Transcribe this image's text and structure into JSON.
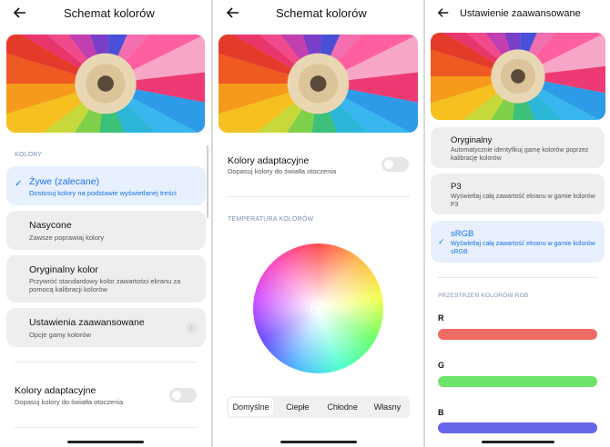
{
  "screen1": {
    "title": "Schemat kolorów",
    "section_label": "KOLORY",
    "options": [
      {
        "title": "Żywe (zalecane)",
        "desc": "Dostosuj kolory na podstawie wyświetlanej treści",
        "selected": true
      },
      {
        "title": "Nasycone",
        "desc": "Zawsze poprawiaj kolory"
      },
      {
        "title": "Oryginalny kolor",
        "desc": "Przywróć standardowy kolor zawartości ekranu za pomocą kalibracji kolorów"
      },
      {
        "title": "Ustawienia zaawansowane",
        "desc": "Opcje gamy kolorów"
      }
    ],
    "adaptive": {
      "title": "Kolory adaptacyjne",
      "desc": "Dopasuj kolory do światła otoczenia",
      "enabled": false
    }
  },
  "screen2": {
    "title": "Schemat kolorów",
    "adaptive": {
      "title": "Kolory adaptacyjne",
      "desc": "Dopasuj kolory do światła otoczenia",
      "enabled": false
    },
    "section_label": "TEMPERATURA KOLORÓW",
    "tabs": [
      "Domyślne",
      "Ciepłe",
      "Chłodne",
      "Własny"
    ],
    "active_tab": "Domyślne"
  },
  "screen3": {
    "title": "Ustawienie zaawansowane",
    "options": [
      {
        "title": "Oryginalny",
        "desc": "Automatycznie identyfikuj gamę kolorów poprzez kalibrację kolorów"
      },
      {
        "title": "P3",
        "desc": "Wyświetlaj całą zawartość ekranu w gamie kolorów P3"
      },
      {
        "title": "sRGB",
        "desc": "Wyświetlaj całą zawartość ekranu w gamie kolorów sRGB",
        "selected": true
      }
    ],
    "section_label": "PRZESTRZEŃ KOLORÓW RGB",
    "channels": [
      {
        "label": "R",
        "color": "#ef6a63"
      },
      {
        "label": "G",
        "color": "#6fe46a"
      },
      {
        "label": "B",
        "color": "#6666ea"
      }
    ]
  },
  "colors": {
    "accent": "#1a73e8",
    "selected_bg": "#e7f0fc",
    "card_bg": "#eeeeee"
  },
  "icons": {
    "back": "arrow-left-icon",
    "check": "check-icon",
    "chevron": "chevron-right-icon"
  }
}
